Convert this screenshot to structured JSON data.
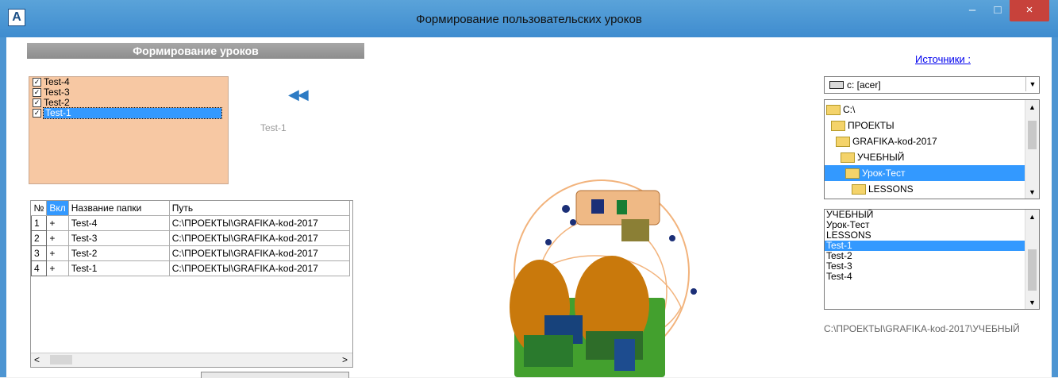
{
  "window": {
    "title": "Формирование пользовательских уроков",
    "icon": "app-icon",
    "minimize": "–",
    "maximize": "□",
    "close": "×"
  },
  "left": {
    "header": "Формирование уроков",
    "checklist": [
      {
        "label": "Test-4",
        "checked": true
      },
      {
        "label": "Test-3",
        "checked": true
      },
      {
        "label": "Test-2",
        "checked": true
      },
      {
        "label": "Test-1",
        "checked": true
      }
    ],
    "arrow_glyph": "◀◀",
    "preview_label": "Test-1",
    "grid": {
      "headers": [
        "№",
        "Вкл",
        "Название папки",
        "Путь"
      ],
      "rows": [
        [
          "1",
          "+",
          "Test-4",
          "C:\\ПРОЕКТЫ\\GRAFIKA-kod-2017"
        ],
        [
          "2",
          "+",
          "Test-3",
          "C:\\ПРОЕКТЫ\\GRAFIKA-kod-2017"
        ],
        [
          "3",
          "+",
          "Test-2",
          "C:\\ПРОЕКТЫ\\GRAFIKA-kod-2017"
        ],
        [
          "4",
          "+",
          "Test-1",
          "C:\\ПРОЕКТЫ\\GRAFIKA-kod-2017"
        ]
      ],
      "scroll_left": "<",
      "scroll_right": ">"
    }
  },
  "right": {
    "sources_label": "Источники :",
    "drive": "c: [acer]",
    "tree": [
      "C:\\",
      "ПРОЕКТЫ",
      "GRAFIKA-kod-2017",
      "УЧЕБНЫЙ",
      "Урок-Тест",
      "LESSONS"
    ],
    "list_items": [
      "УЧЕБНЫЙ",
      "Урок-Тест",
      "LESSONS",
      "Test-1",
      "Test-2",
      "Test-3",
      "Test-4"
    ],
    "path": "C:\\ПРОЕКТЫ\\GRAFIKA-kod-2017\\УЧЕБНЫЙ"
  },
  "colors": {
    "titlebar": "#4a97d6",
    "selection": "#3399ff",
    "checklist_bg": "#f7c8a3",
    "close": "#c7423b"
  }
}
